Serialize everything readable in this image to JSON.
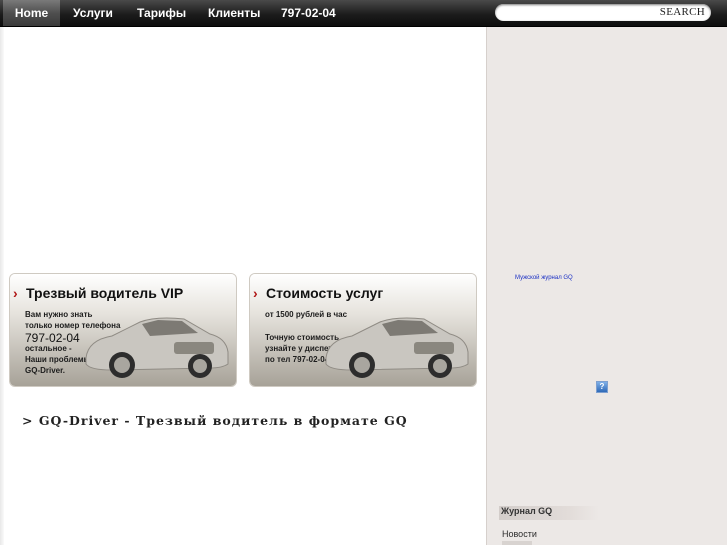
{
  "nav": {
    "items": [
      {
        "label": "Home"
      },
      {
        "label": "Услуги"
      },
      {
        "label": "Тарифы"
      },
      {
        "label": "Клиенты"
      }
    ],
    "phone": "797-02-04",
    "search": {
      "value": "",
      "button_label": "SEARCH"
    }
  },
  "promos": [
    {
      "title": "Трезвый водитель VIP",
      "lines": [
        "Вам нужно знать",
        "только номер телефона"
      ],
      "phone": "797-02-04",
      "lines_after": [
        "остальное -",
        "Наши проблемы",
        "GQ-Driver."
      ]
    },
    {
      "title": "Стоимость услуг",
      "lines": [
        "от 1500 рублей в час"
      ],
      "lines_after": [
        "Точную стоимость",
        "узнайте у диспетчера",
        "по тел 797-02-04"
      ]
    }
  ],
  "headline": "> GQ-Driver - Трезвый водитель в формате GQ",
  "sidebar": {
    "link": "Мужской журнал GQ",
    "help_icon": "?",
    "section_heading": "Журнал GQ",
    "items": [
      "Новости"
    ]
  },
  "colors": {
    "accent": "#b01818",
    "topbar": "#1c1c1c",
    "sidebar_bg": "#ece8e6",
    "link": "#1a2fc4"
  }
}
